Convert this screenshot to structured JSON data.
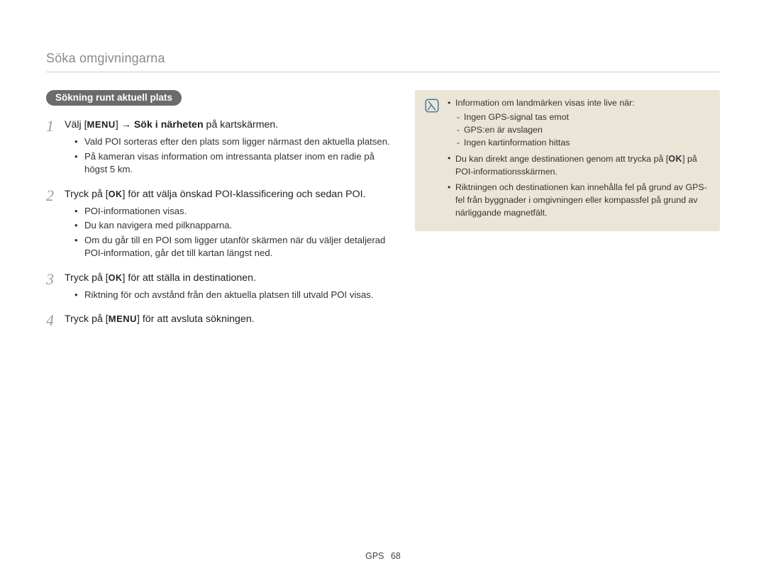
{
  "header": {
    "title": "Söka omgivningarna"
  },
  "pill": {
    "label": "Sökning runt aktuell plats"
  },
  "icons": {
    "menu": "MENU",
    "ok": "OK"
  },
  "steps": [
    {
      "num": "1",
      "prefix": "Välj [",
      "mid": "] → ",
      "bold": "Sök i närheten",
      "suffix": " på kartskärmen.",
      "bullets": [
        "Vald POI sorteras efter den plats som ligger närmast den aktuella platsen.",
        "På kameran visas information om intressanta platser inom en radie på högst 5 km."
      ]
    },
    {
      "num": "2",
      "prefix": "Tryck på [",
      "suffix": "] för att välja önskad POI-klassificering och sedan POI.",
      "bullets": [
        "POI-informationen visas.",
        "Du kan navigera med pilknapparna.",
        "Om du går till en POI som ligger utanför skärmen när du väljer detaljerad POI-information, går det till kartan längst ned."
      ]
    },
    {
      "num": "3",
      "prefix": "Tryck på [",
      "suffix": "] för att ställa in destinationen.",
      "bullets": [
        "Riktning för och avstånd från den aktuella platsen till utvald POI visas."
      ]
    },
    {
      "num": "4",
      "prefix": "Tryck på [",
      "suffix": "] för att avsluta sökningen.",
      "bullets": []
    }
  ],
  "note": {
    "items": [
      {
        "text": "Information om landmärken visas inte live när:",
        "sub": [
          "Ingen GPS-signal tas emot",
          "GPS:en är avslagen",
          "Ingen kartinformation hittas"
        ]
      },
      {
        "pre": "Du kan direkt ange destinationen genom att trycka på [",
        "post": "] på POI-informationsskärmen."
      },
      {
        "text": "Riktningen och destinationen kan innehålla fel på grund av GPS-fel från byggnader i omgivningen eller kompassfel på grund av närliggande magnetfält."
      }
    ]
  },
  "footer": {
    "section": "GPS",
    "page": "68"
  }
}
